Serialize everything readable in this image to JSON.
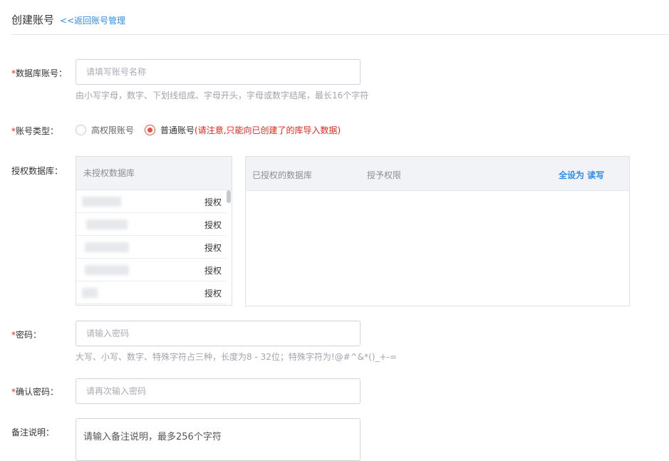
{
  "header": {
    "title": "创建账号",
    "back_link": "<<返回账号管理"
  },
  "db_account": {
    "required_mark": "*",
    "label": "数据库账号：",
    "placeholder": "请填写账号名称",
    "hint": "由小写字母，数字、下划线组成、字母开头，字母或数字结尾，最长16个字符"
  },
  "account_type": {
    "required_mark": "*",
    "label": "账号类型：",
    "options": [
      {
        "label": "高权限账号",
        "checked": false
      },
      {
        "label": "普通账号",
        "checked": true
      }
    ],
    "note": "(请注意,只能向已创建了的库导入数据)"
  },
  "authorize_db": {
    "label": "授权数据库：",
    "left_panel": {
      "header": "未授权数据库",
      "rows": [
        {
          "action": "授权"
        },
        {
          "action": "授权"
        },
        {
          "action": "授权"
        },
        {
          "action": "授权"
        },
        {
          "action": "授权"
        }
      ]
    },
    "right_panel": {
      "col1": "已授权的数据库",
      "col2": "授予权限",
      "action": "全设为 读写"
    }
  },
  "password": {
    "required_mark": "*",
    "label": "密码：",
    "placeholder": "请输入密码",
    "hint": "大写、小写、数字、特殊字符占三种，长度为8 - 32位；特殊字符为!@#^&*()_+-="
  },
  "confirm_password": {
    "required_mark": "*",
    "label": "确认密码：",
    "placeholder": "请再次输入密码"
  },
  "remark": {
    "label": "备注说明：",
    "placeholder": "请输入备注说明，最多256个字符"
  },
  "colors": {
    "accent": "#2d8cf0",
    "required": "#e5271d",
    "radio_checked": "#e9513f"
  }
}
